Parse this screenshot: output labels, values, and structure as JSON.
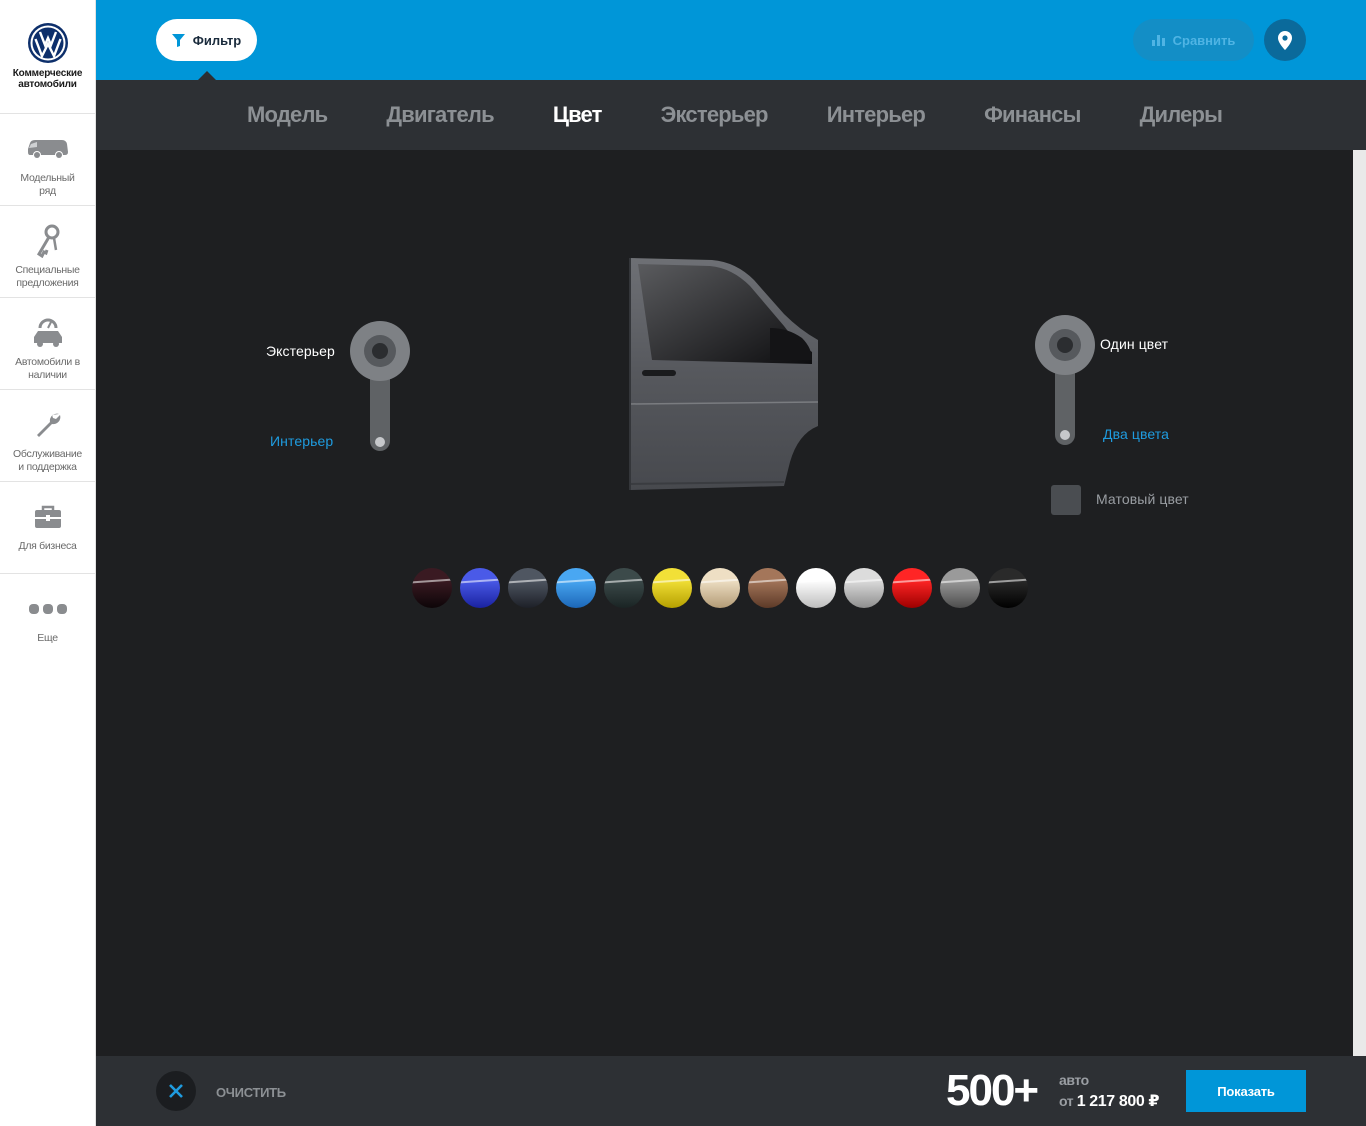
{
  "brand": {
    "logo_icon": "volkswagen-logo",
    "text_line1": "Коммерческие",
    "text_line2": "автомобили"
  },
  "sidebar": {
    "items": [
      {
        "line1": "Модельный",
        "line2": "ряд",
        "icon": "van-icon"
      },
      {
        "line1": "Специальные",
        "line2": "предложения",
        "icon": "keys-icon"
      },
      {
        "line1": "Автомобили в",
        "line2": "наличии",
        "icon": "car-dealer-icon"
      },
      {
        "line1": "Обслуживание",
        "line2": "и поддержка",
        "icon": "wrench-icon"
      },
      {
        "line1": "Для бизнеса",
        "line2": "",
        "icon": "briefcase-icon"
      },
      {
        "line1": "Еще",
        "line2": "",
        "icon": "more-dots-icon"
      }
    ]
  },
  "header": {
    "filter_label": "Фильтр",
    "compare_label": "Сравнить",
    "accent_color": "#0096d8"
  },
  "tabs": [
    {
      "label": "Модель",
      "active": false
    },
    {
      "label": "Двигатель",
      "active": false
    },
    {
      "label": "Цвет",
      "active": true
    },
    {
      "label": "Экстерьер",
      "active": false
    },
    {
      "label": "Интерьер",
      "active": false
    },
    {
      "label": "Финансы",
      "active": false
    },
    {
      "label": "Дилеры",
      "active": false
    }
  ],
  "color_panel": {
    "area_toggle": {
      "top_label": "Экстерьер",
      "bottom_label": "Интерьер",
      "selected": "Экстерьер"
    },
    "tone_toggle": {
      "top_label": "Один цвет",
      "bottom_label": "Два цвета",
      "selected": "Один цвет"
    },
    "matte_label": "Матовый цвет",
    "matte_checked": false,
    "preview_icon": "van-door-preview"
  },
  "swatches": [
    {
      "name": "burgundy-black",
      "top": "#3a1a22",
      "bottom": "#0d0508"
    },
    {
      "name": "blue",
      "top": "#4a5ae8",
      "bottom": "#1a22a0"
    },
    {
      "name": "dark-slate",
      "top": "#4f5661",
      "bottom": "#1d2028"
    },
    {
      "name": "light-blue",
      "top": "#49a7f2",
      "bottom": "#1c67b8"
    },
    {
      "name": "dark-green-grey",
      "top": "#3c4a4a",
      "bottom": "#1a2424"
    },
    {
      "name": "yellow",
      "top": "#f2e037",
      "bottom": "#b5a000"
    },
    {
      "name": "beige",
      "top": "#eedfc4",
      "bottom": "#b39b76"
    },
    {
      "name": "brown",
      "top": "#a4765a",
      "bottom": "#5d3a28"
    },
    {
      "name": "white",
      "top": "#ffffff",
      "bottom": "#bdbdbd"
    },
    {
      "name": "silver",
      "top": "#dcdcdc",
      "bottom": "#8e8e8e"
    },
    {
      "name": "red",
      "top": "#ff2525",
      "bottom": "#9d0000"
    },
    {
      "name": "grey",
      "top": "#9a9a9a",
      "bottom": "#4d4d4d"
    },
    {
      "name": "black",
      "top": "#2a2a2a",
      "bottom": "#000000"
    }
  ],
  "footer": {
    "clear_label": "ОЧИСТИТЬ",
    "count": "500+",
    "auto_word": "авто",
    "price_prefix": "от",
    "price": "1 217 800 ₽",
    "show_label": "Показать"
  }
}
